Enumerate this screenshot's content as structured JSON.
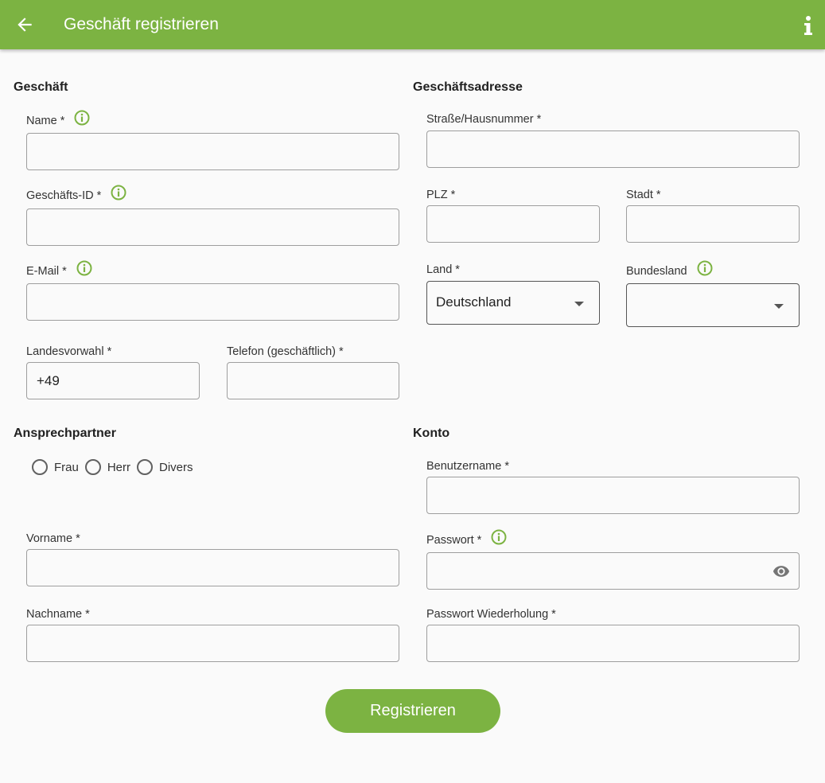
{
  "appbar": {
    "title": "Geschäft registrieren",
    "back_icon": "arrow-left-icon",
    "info_icon": "info-icon"
  },
  "colors": {
    "primary": "#7cb342",
    "background": "#fafafa",
    "border": "#9e9e9e"
  },
  "business": {
    "section": "Geschäft",
    "name_label": "Name *",
    "name_value": "",
    "id_label": "Geschäfts-ID *",
    "id_value": "",
    "email_label": "E-Mail *",
    "email_value": "",
    "country_code_label": "Landesvorwahl *",
    "country_code_value": "+49",
    "phone_label": "Telefon (geschäftlich) *",
    "phone_value": ""
  },
  "address": {
    "section": "Geschäftsadresse",
    "street_label": "Straße/Hausnummer *",
    "street_value": "",
    "zip_label": "PLZ *",
    "zip_value": "",
    "city_label": "Stadt *",
    "city_value": "",
    "country_label": "Land *",
    "country_value": "Deutschland",
    "state_label": "Bundesland",
    "state_value": ""
  },
  "contact": {
    "section": "Ansprechpartner",
    "salutations": [
      "Frau",
      "Herr",
      "Divers"
    ],
    "firstname_label": "Vorname *",
    "firstname_value": "",
    "lastname_label": "Nachname *",
    "lastname_value": ""
  },
  "account": {
    "section": "Konto",
    "username_label": "Benutzername *",
    "username_value": "",
    "password_label": "Passwort *",
    "password_value": "",
    "password_repeat_label": "Passwort Wiederholung *",
    "password_repeat_value": ""
  },
  "submit_label": "Registrieren"
}
